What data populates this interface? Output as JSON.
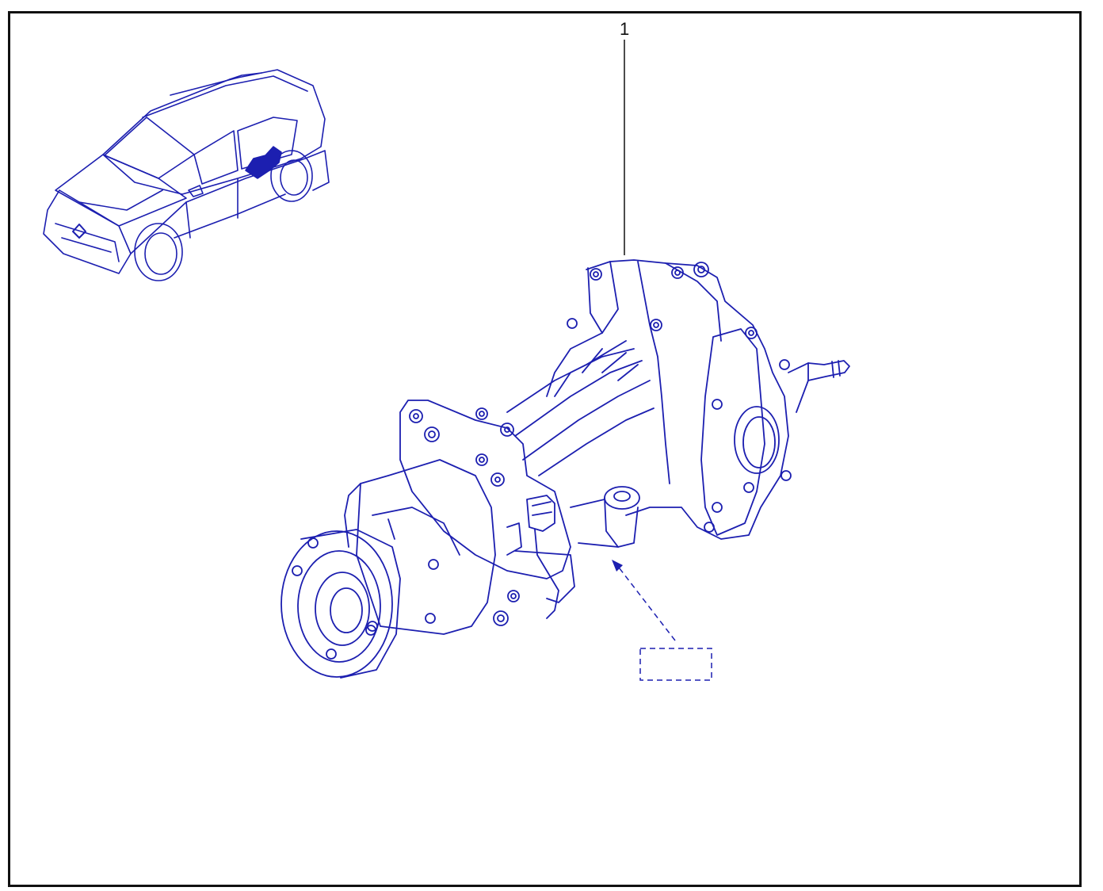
{
  "colors": {
    "ink": "#1c1fb0",
    "frame": "#111111",
    "background": "#ffffff",
    "callout": "#111111"
  },
  "callouts": [
    {
      "label": "1"
    }
  ],
  "icons": {
    "vehicle": "car-location-icon",
    "part": "rear-differential-icon",
    "reference": "reference-box-icon"
  }
}
